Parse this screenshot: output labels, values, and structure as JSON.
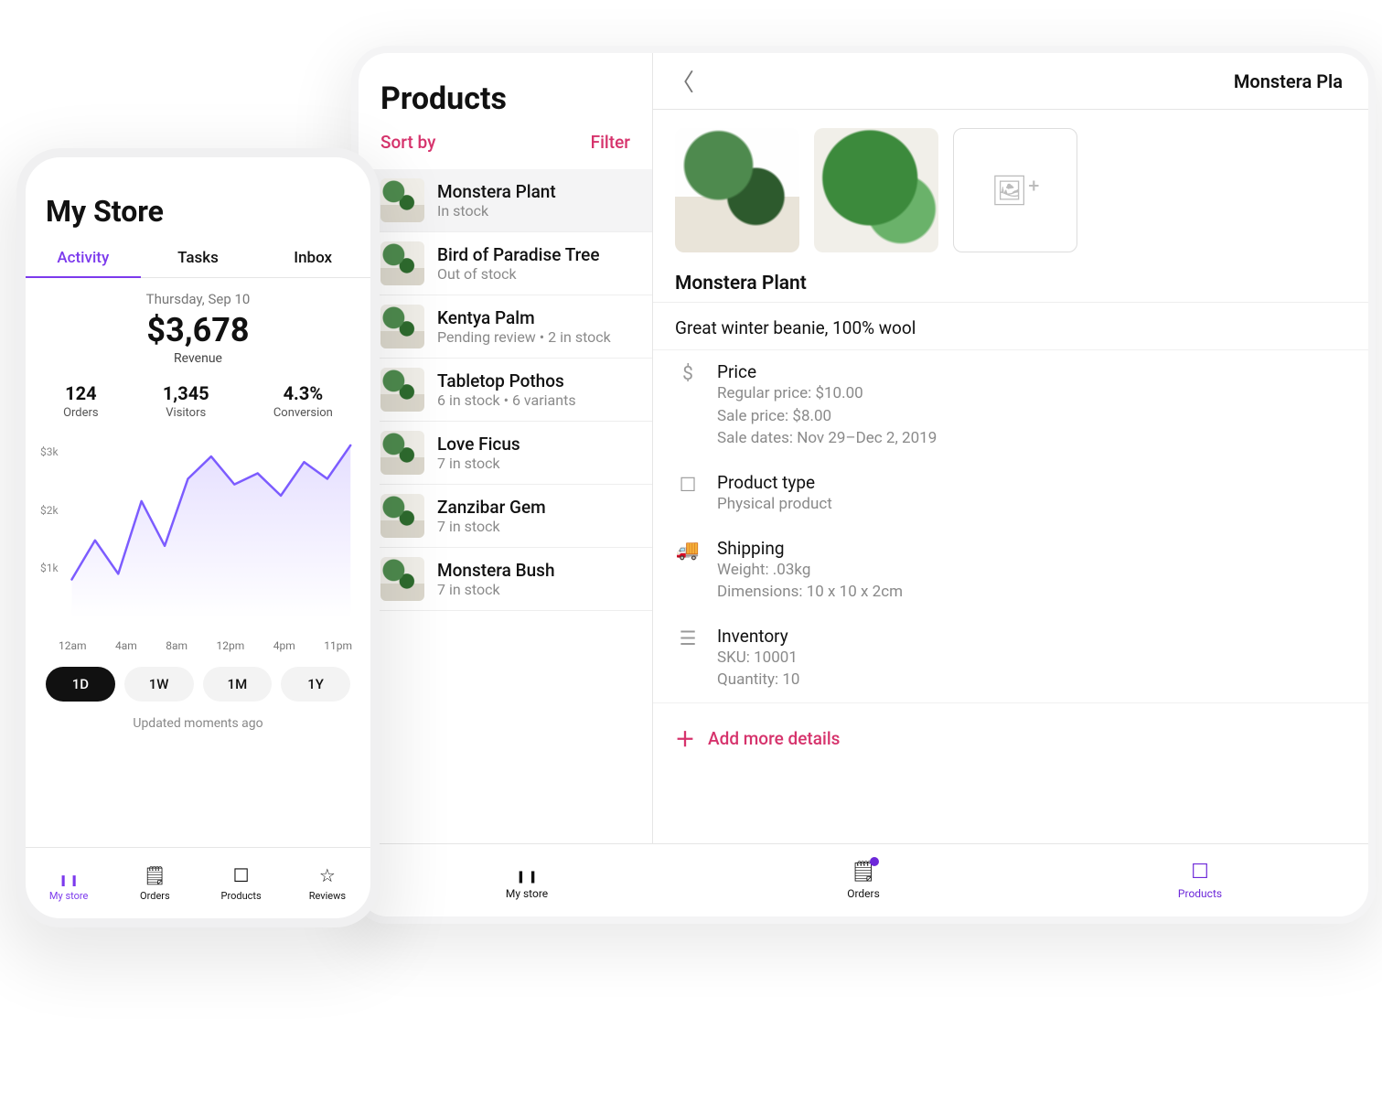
{
  "phone": {
    "title": "My Store",
    "tabs": [
      "Activity",
      "Tasks",
      "Inbox"
    ],
    "active_tab": 0,
    "summary": {
      "date": "Thursday, Sep 10",
      "revenue_value": "$3,678",
      "revenue_label": "Revenue"
    },
    "kpis": [
      {
        "value": "124",
        "label": "Orders"
      },
      {
        "value": "1,345",
        "label": "Visitors"
      },
      {
        "value": "4.3%",
        "label": "Conversion"
      }
    ],
    "range_buttons": [
      "1D",
      "1W",
      "1M",
      "1Y"
    ],
    "active_range": 0,
    "updated_text": "Updated moments ago",
    "tabbar": [
      {
        "icon": "bars-icon",
        "label": "My store",
        "active": true
      },
      {
        "icon": "note-icon",
        "label": "Orders",
        "active": false
      },
      {
        "icon": "box-icon",
        "label": "Products",
        "active": false
      },
      {
        "icon": "star-icon",
        "label": "Reviews",
        "active": false
      }
    ]
  },
  "chart_data": {
    "type": "line",
    "title": "Revenue",
    "x_ticks": [
      "12am",
      "4am",
      "8am",
      "12pm",
      "4pm",
      "11pm"
    ],
    "y_ticks": [
      "$1k",
      "$2k",
      "$3k"
    ],
    "ylim": [
      0,
      3200
    ],
    "x": [
      0,
      1,
      2,
      3,
      4,
      5,
      6,
      7,
      8,
      9,
      10,
      11,
      12
    ],
    "series": [
      {
        "name": "Revenue",
        "values": [
          700,
          1400,
          800,
          2100,
          1300,
          2500,
          2900,
          2400,
          2600,
          2200,
          2800,
          2500,
          3100
        ]
      }
    ],
    "accent": "#7c5cff"
  },
  "tablet": {
    "list_title": "Products",
    "sort_label": "Sort by",
    "filter_label": "Filter",
    "products": [
      {
        "name": "Monstera Plant",
        "subtitle": "In stock",
        "selected": true
      },
      {
        "name": "Bird of Paradise Tree",
        "subtitle": "Out of stock",
        "selected": false
      },
      {
        "name": "Kentya Palm",
        "subtitle": "Pending review • 2 in stock",
        "selected": false
      },
      {
        "name": "Tabletop Pothos",
        "subtitle": "6 in stock • 6 variants",
        "selected": false
      },
      {
        "name": "Love Ficus",
        "subtitle": "7 in stock",
        "selected": false
      },
      {
        "name": "Zanzibar Gem",
        "subtitle": "7 in stock",
        "selected": false
      },
      {
        "name": "Monstera Bush",
        "subtitle": "7 in stock",
        "selected": false
      }
    ],
    "detail": {
      "header_title": "Monstera Pla",
      "product_name": "Monstera Plant",
      "description": "Great winter beanie, 100% wool",
      "attrs": {
        "price": {
          "heading": "Price",
          "lines": [
            "Regular price: $10.00",
            "Sale price: $8.00",
            "Sale dates: Nov 29–Dec 2, 2019"
          ]
        },
        "type": {
          "heading": "Product type",
          "lines": [
            "Physical product"
          ]
        },
        "shipping": {
          "heading": "Shipping",
          "lines": [
            "Weight: .03kg",
            "Dimensions: 10 x 10 x 2cm"
          ]
        },
        "inventory": {
          "heading": "Inventory",
          "lines": [
            "SKU: 10001",
            "Quantity: 10"
          ]
        }
      },
      "add_more_label": "Add more details"
    },
    "tabbar": [
      {
        "icon": "bars-icon",
        "label": "My store",
        "active": false,
        "notif": false
      },
      {
        "icon": "note-icon",
        "label": "Orders",
        "active": false,
        "notif": true
      },
      {
        "icon": "box-icon",
        "label": "Products",
        "active": true,
        "notif": false
      }
    ]
  }
}
